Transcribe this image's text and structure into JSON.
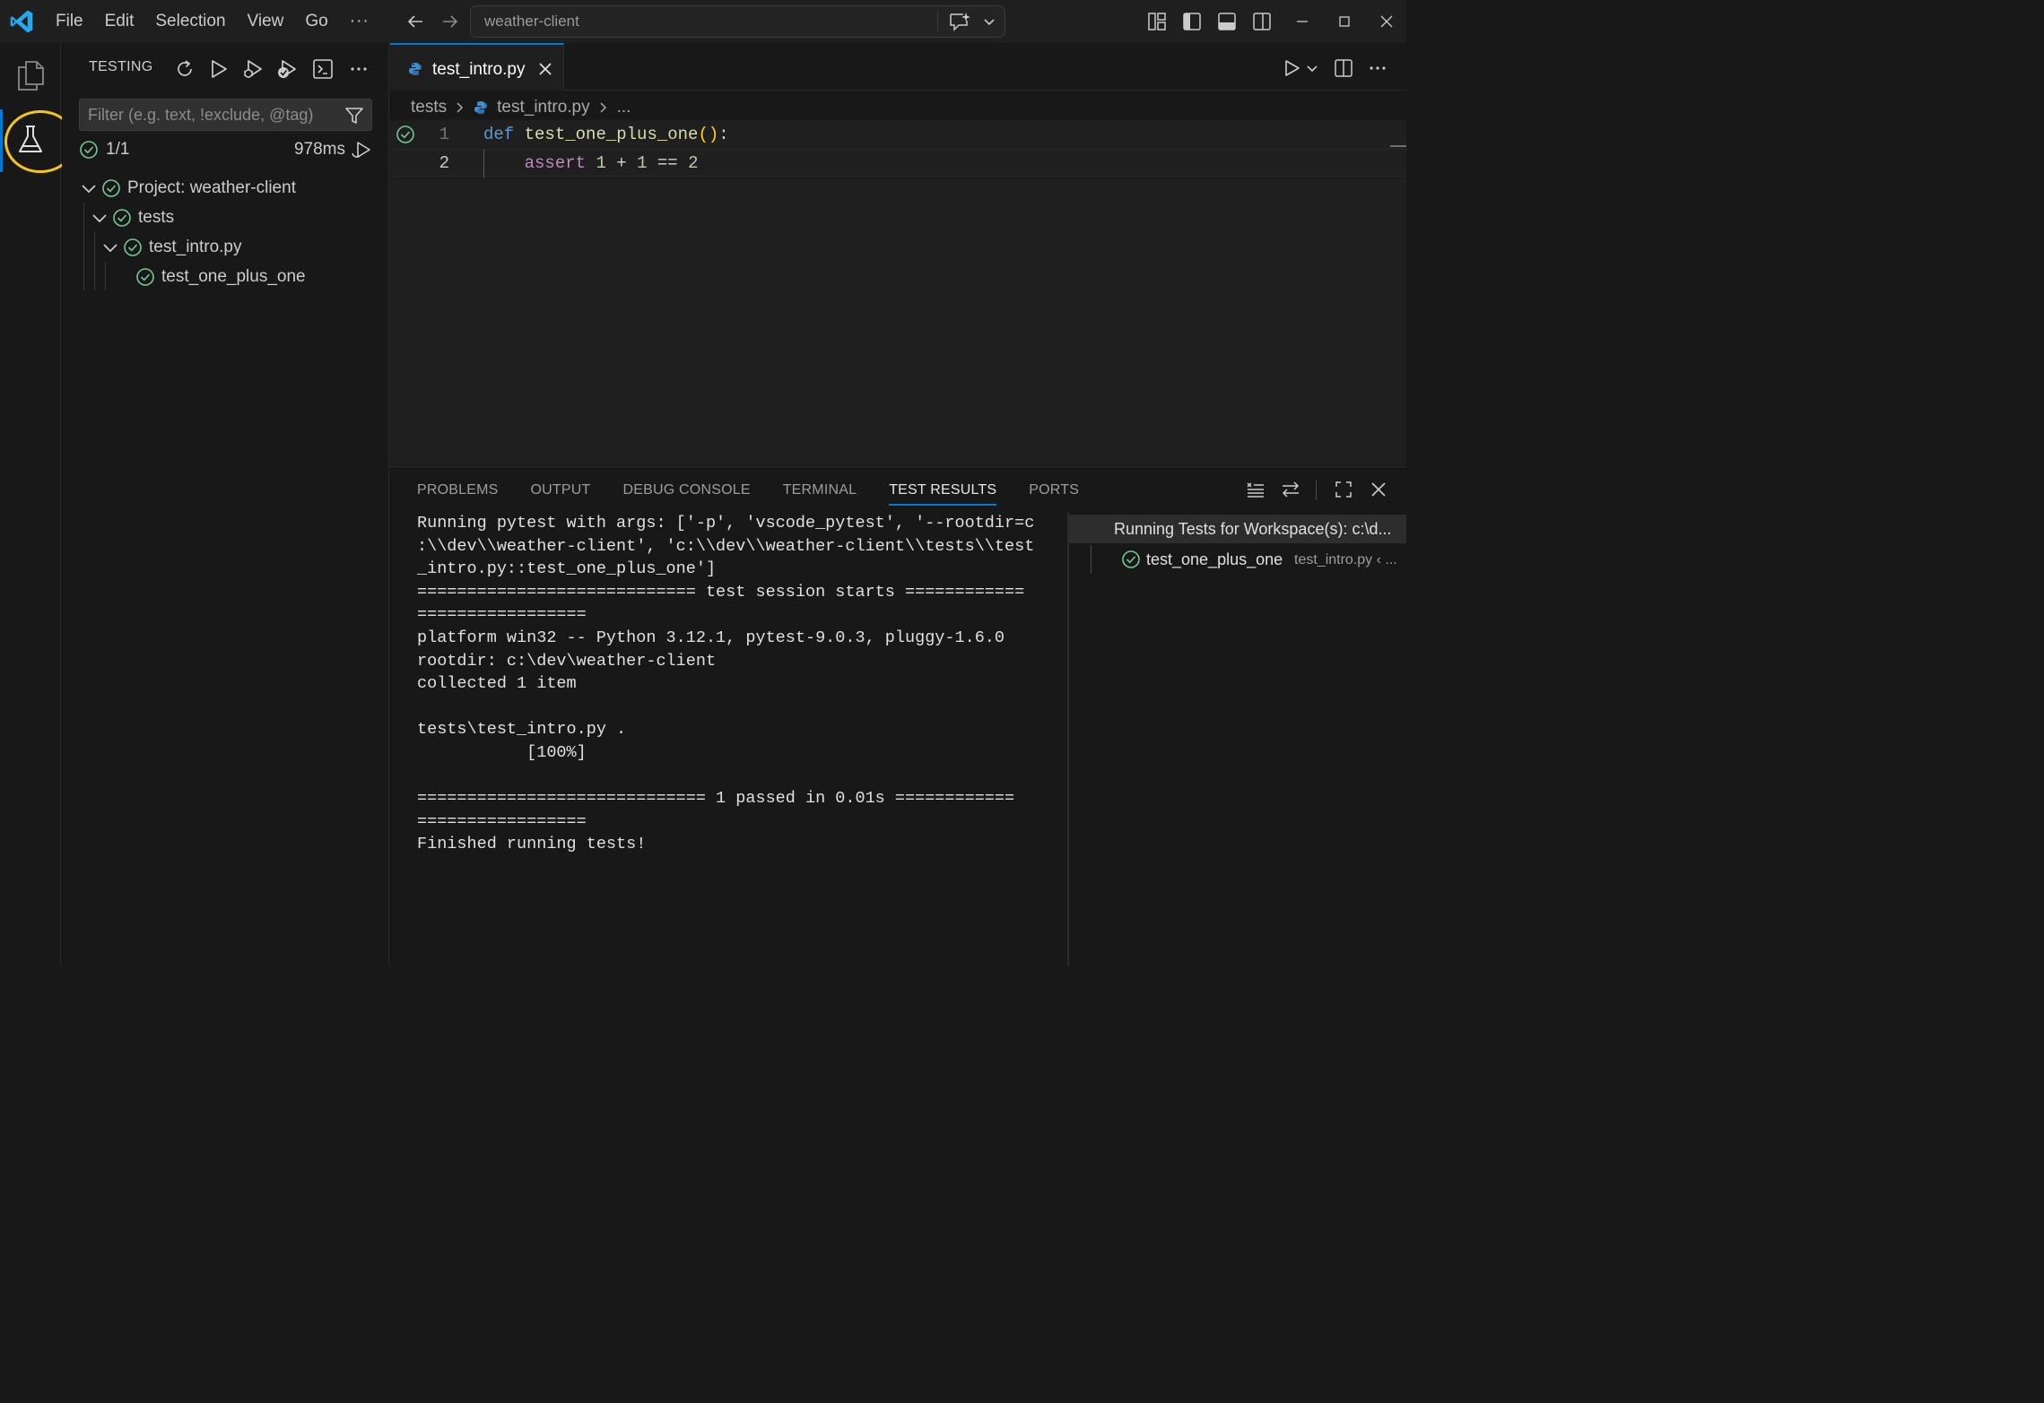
{
  "window": {
    "menu": [
      "File",
      "Edit",
      "Selection",
      "View",
      "Go"
    ],
    "menu_more": "···",
    "command_center": "weather-client"
  },
  "sidebar": {
    "title": "TESTING",
    "filter_placeholder": "Filter (e.g. text, !exclude, @tag)",
    "summary": {
      "count": "1/1",
      "duration": "978ms"
    },
    "tree": [
      {
        "label": "Project: weather-client",
        "status": "passed"
      },
      {
        "label": "tests",
        "status": "passed"
      },
      {
        "label": "test_intro.py",
        "status": "passed"
      },
      {
        "label": "test_one_plus_one",
        "status": "passed"
      }
    ]
  },
  "editor": {
    "tab": {
      "name": "test_intro.py"
    },
    "breadcrumb": [
      "tests",
      "test_intro.py",
      "..."
    ],
    "lines": [
      {
        "number": "1",
        "tokens": [
          {
            "t": "def",
            "c": "kw"
          },
          {
            "t": " ",
            "c": "op"
          },
          {
            "t": "test_one_plus_one",
            "c": "fn"
          },
          {
            "t": "()",
            "c": "par"
          },
          {
            "t": ":",
            "c": "op"
          }
        ]
      },
      {
        "number": "2",
        "tokens": [
          {
            "t": "    ",
            "c": "op"
          },
          {
            "t": "assert",
            "c": "kw2"
          },
          {
            "t": " ",
            "c": "op"
          },
          {
            "t": "1",
            "c": "num"
          },
          {
            "t": " + ",
            "c": "op"
          },
          {
            "t": "1",
            "c": "num"
          },
          {
            "t": " == ",
            "c": "op"
          },
          {
            "t": "2",
            "c": "num"
          }
        ]
      }
    ]
  },
  "panel": {
    "tabs": [
      "PROBLEMS",
      "OUTPUT",
      "DEBUG CONSOLE",
      "TERMINAL",
      "TEST RESULTS",
      "PORTS"
    ],
    "active_tab": "TEST RESULTS",
    "output_lines": [
      "Running pytest with args: ['-p', 'vscode_pytest', '--rootdir=c",
      ":\\\\dev\\\\weather-client', 'c:\\\\dev\\\\weather-client\\\\tests\\\\test",
      "_intro.py::test_one_plus_one']",
      "============================ test session starts ============",
      "=================",
      "platform win32 -- Python 3.12.1, pytest-9.0.3, pluggy-1.6.0",
      "rootdir: c:\\dev\\weather-client",
      "collected 1 item",
      "",
      "tests\\test_intro.py .",
      "           [100%]",
      "",
      "============================= 1 passed in 0.01s ============",
      "=================",
      "Finished running tests!"
    ],
    "results": {
      "header": "Running Tests for Workspace(s): c:\\d...",
      "item": {
        "name": "test_one_plus_one",
        "location": "test_intro.py ‹ ..."
      }
    }
  },
  "colors": {
    "accent": "#0078d4",
    "pass": "#73c991",
    "highlight_ring": "#f5c518",
    "logo": "#23a9f2"
  },
  "icons": {
    "titlebar": [
      "vscode-logo-icon",
      "back-arrow-icon",
      "forward-arrow-icon",
      "chat-sparkle-icon",
      "customize-layout-icon",
      "toggle-sidebar-icon",
      "toggle-panel-icon",
      "toggle-secondary-sidebar-icon",
      "minimize-icon",
      "maximize-icon",
      "close-window-icon"
    ],
    "activity": [
      "explorer-files-icon",
      "testing-beaker-icon"
    ],
    "sidebar_actions": [
      "refresh-icon",
      "run-all-icon",
      "debug-all-icon",
      "run-coverage-icon",
      "show-output-icon",
      "more-actions-icon"
    ],
    "panel_actions": [
      "collapse-all-icon",
      "toggle-view-icon",
      "maximize-panel-icon",
      "close-panel-icon"
    ]
  }
}
